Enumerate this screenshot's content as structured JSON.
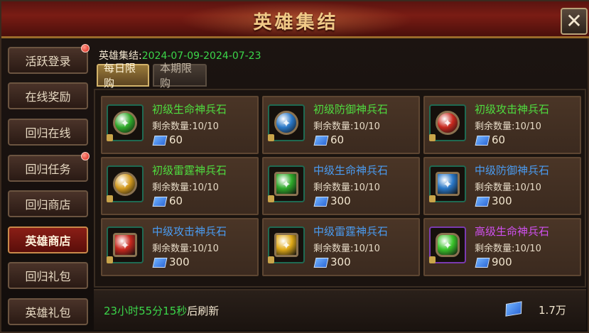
{
  "window": {
    "title": "英雄集结"
  },
  "close_icon": "close-x-icon",
  "sidebar": {
    "items": [
      {
        "label": "活跃登录",
        "active": false,
        "badge": true
      },
      {
        "label": "在线奖励",
        "active": false,
        "badge": false
      },
      {
        "label": "回归在线",
        "active": false,
        "badge": false
      },
      {
        "label": "回归任务",
        "active": false,
        "badge": true
      },
      {
        "label": "回归商店",
        "active": false,
        "badge": false
      },
      {
        "label": "英雄商店",
        "active": true,
        "badge": false
      },
      {
        "label": "回归礼包",
        "active": false,
        "badge": false
      },
      {
        "label": "英雄礼包",
        "active": false,
        "badge": false
      }
    ]
  },
  "event": {
    "label": "英雄集结:",
    "dates": "2024-07-09-2024-07-23"
  },
  "tabs": [
    {
      "label": "每日限购",
      "active": true
    },
    {
      "label": "本期限购",
      "active": false
    }
  ],
  "items": [
    {
      "name": "初级生命神兵石",
      "remain": "剩余数量:10/10",
      "price": "60",
      "rarity": "green",
      "gem_color": "#2faa2a",
      "shape": "round"
    },
    {
      "name": "初级防御神兵石",
      "remain": "剩余数量:10/10",
      "price": "60",
      "rarity": "green",
      "gem_color": "#2a78c8",
      "shape": "round"
    },
    {
      "name": "初级攻击神兵石",
      "remain": "剩余数量:10/10",
      "price": "60",
      "rarity": "green",
      "gem_color": "#c8281e",
      "shape": "round"
    },
    {
      "name": "初级雷霆神兵石",
      "remain": "剩余数量:10/10",
      "price": "60",
      "rarity": "green",
      "gem_color": "#d39a1e",
      "shape": "round"
    },
    {
      "name": "中级生命神兵石",
      "remain": "剩余数量:10/10",
      "price": "300",
      "rarity": "blue",
      "gem_color": "#2faa2a",
      "shape": "square"
    },
    {
      "name": "中级防御神兵石",
      "remain": "剩余数量:10/10",
      "price": "300",
      "rarity": "blue",
      "gem_color": "#2a78c8",
      "shape": "square"
    },
    {
      "name": "中级攻击神兵石",
      "remain": "剩余数量:10/10",
      "price": "300",
      "rarity": "blue",
      "gem_color": "#c8281e",
      "shape": "square"
    },
    {
      "name": "中级雷霆神兵石",
      "remain": "剩余数量:10/10",
      "price": "300",
      "rarity": "blue",
      "gem_color": "#e0aa18",
      "shape": "square"
    },
    {
      "name": "高级生命神兵石",
      "remain": "剩余数量:10/10",
      "price": "900",
      "rarity": "purple",
      "gem_color": "#3ac42a",
      "shape": "oct"
    }
  ],
  "footer": {
    "time": "23小时55分15秒",
    "suffix": "后刷新",
    "balance": "1.7万"
  },
  "colors": {
    "accent": "#f0c987",
    "green_text": "#3bd64a",
    "title_red": "#7a1c14"
  }
}
